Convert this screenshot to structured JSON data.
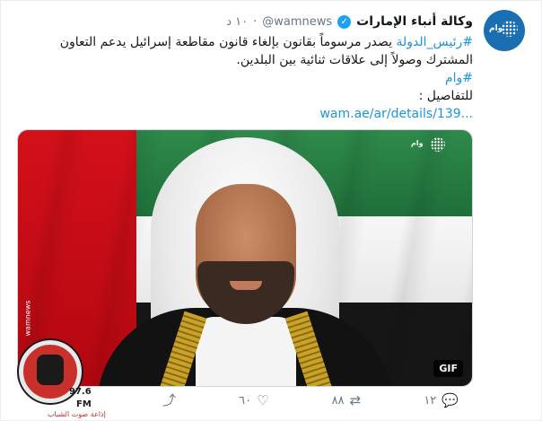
{
  "tweet": {
    "display_name": "وكالة أنباء الإمارات",
    "handle": "@wamnews",
    "separator": "·",
    "time": "١٠ د",
    "verified_icon": "verified-badge-icon",
    "avatar_text": "وام",
    "text": {
      "hashtag_1": "#رئيس_الدولة",
      "line_1": "يصدر مرسوماً بقانون بإلغاء قانون مقاطعة إسرائيل يدعم التعاون المشترك وصولاً إلى علاقات ثنائية بين البلدين.",
      "hashtag_2": "#وام",
      "details_label": "للتفاصيل :",
      "link": "wam.ae/ar/details/139..."
    },
    "media": {
      "badge": "GIF",
      "logo_text": "وام",
      "side_text": "wamnews",
      "flag_colors": {
        "red": "#d4101a",
        "green": "#2e8a4b",
        "white": "#f7f7f7",
        "black": "#161616"
      }
    },
    "overlay": {
      "frequency": "97.6",
      "band": "FM",
      "station": "إذاعة صوت الشباب"
    },
    "actions": {
      "reply_count": "١٢",
      "retweet_count": "٨٨",
      "like_count": "٦٠",
      "reply_icon": "reply-icon",
      "retweet_icon": "retweet-icon",
      "like_icon": "heart-icon",
      "share_icon": "share-icon"
    }
  },
  "colors": {
    "accent": "#1b95e0",
    "muted": "#657786",
    "text": "#14171a"
  }
}
